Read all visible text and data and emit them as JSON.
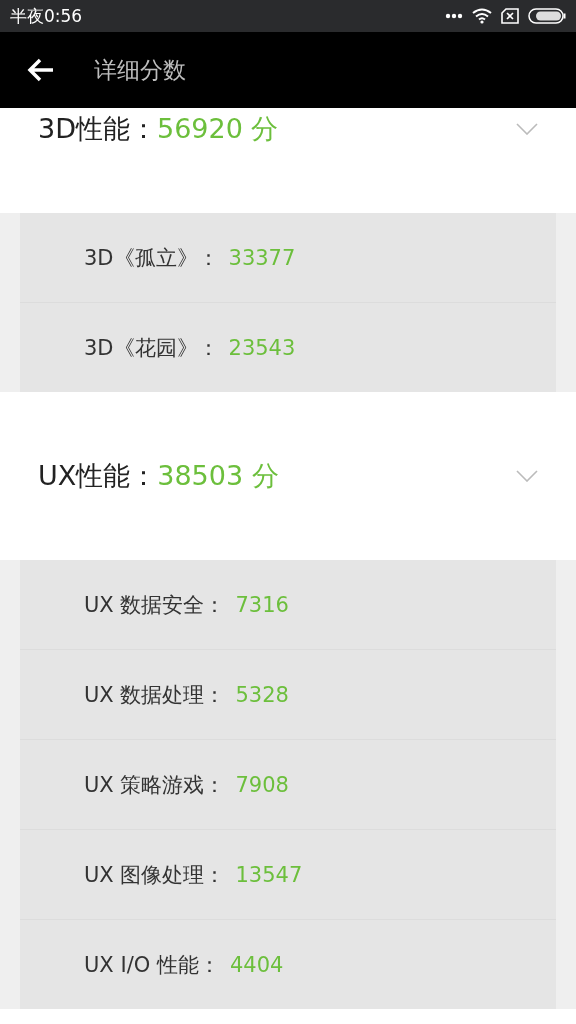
{
  "status_bar": {
    "time": "半夜0:56"
  },
  "header": {
    "title": "详细分数"
  },
  "sections": [
    {
      "label": "3D性能：",
      "score": "56920",
      "unit": "分",
      "expanded": true,
      "items": [
        {
          "label": "3D《孤立》：",
          "value": "33377"
        },
        {
          "label": "3D《花园》：",
          "value": "23543"
        }
      ]
    },
    {
      "label": "UX性能：",
      "score": "38503",
      "unit": "分",
      "expanded": true,
      "items": [
        {
          "label": "UX 数据安全：",
          "value": "7316"
        },
        {
          "label": "UX 数据处理：",
          "value": "5328"
        },
        {
          "label": "UX 策略游戏：",
          "value": "7908"
        },
        {
          "label": "UX 图像处理：",
          "value": "13547"
        },
        {
          "label": "UX I/O 性能：",
          "value": "4404"
        }
      ]
    }
  ]
}
